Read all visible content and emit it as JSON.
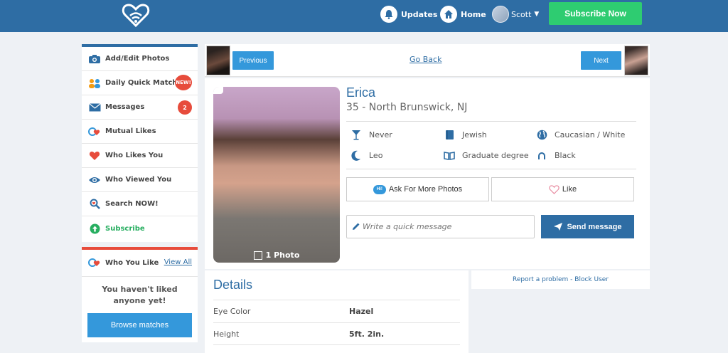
{
  "topbar": {
    "updates": "Updates",
    "home": "Home",
    "user": "Scott",
    "subscribe": "Subscribe Now"
  },
  "sidebar": {
    "items": [
      {
        "label": "Add/Edit Photos"
      },
      {
        "label": "Daily Quick Match",
        "badge": "NEW!"
      },
      {
        "label": "Messages",
        "badge": "2"
      },
      {
        "label": "Mutual Likes"
      },
      {
        "label": "Who Likes You"
      },
      {
        "label": "Who Viewed You"
      },
      {
        "label": "Search NOW!"
      },
      {
        "label": "Subscribe"
      }
    ]
  },
  "likes": {
    "title": "Who You Like",
    "view_all": "View All",
    "empty": "You haven't liked anyone yet!",
    "browse": "Browse matches"
  },
  "nav": {
    "previous": "Previous",
    "go_back": "Go Back",
    "next": "Next"
  },
  "profile": {
    "name": "Erica",
    "age_location": "35 - North Brunswick, NJ",
    "photo_count": "1 Photo",
    "attrs": {
      "drink": "Never",
      "religion": "Jewish",
      "ethnicity": "Caucasian / White",
      "sign": "Leo",
      "education": "Graduate degree",
      "hair": "Black"
    },
    "ask_photos": "Ask For More Photos",
    "like": "Like",
    "message_placeholder": "Write a quick message",
    "send": "Send message"
  },
  "report": "Report a problem - Block User",
  "details": {
    "title": "Details",
    "rows": [
      {
        "k": "Eye Color",
        "v": "Hazel"
      },
      {
        "k": "Height",
        "v": "5ft. 2in."
      }
    ]
  },
  "colors": {
    "brand": "#2e6da4",
    "accent_green": "#2ecc71",
    "button_blue": "#3498db",
    "badge_red": "#e74c3c"
  }
}
